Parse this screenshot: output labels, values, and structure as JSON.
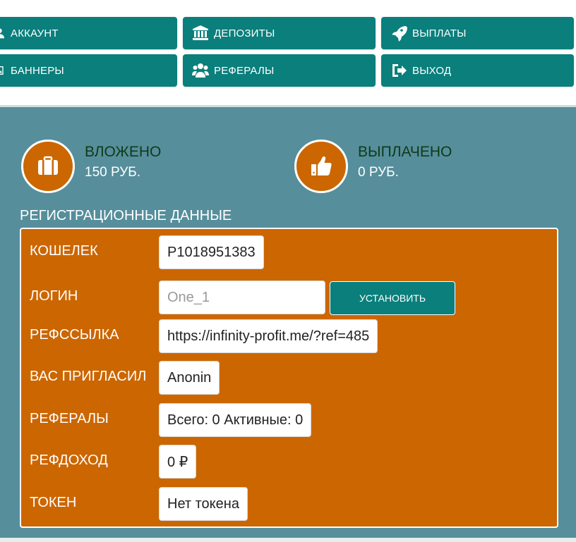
{
  "nav": {
    "account": "АККАУНТ",
    "deposits": "ДЕПОЗИТЫ",
    "payouts": "ВЫПЛАТЫ",
    "banners": "БАННЕРЫ",
    "referrals": "РЕФЕРАЛЫ",
    "logout": "ВЫХОД"
  },
  "stats": {
    "invested": {
      "title": "ВЛОЖЕНО",
      "value": "150 РУБ."
    },
    "paid": {
      "title": "ВЫПЛАЧЕНО",
      "value": "0 РУБ."
    }
  },
  "registration": {
    "title": "РЕГИСТРАЦИОННЫЕ ДАННЫЕ",
    "wallet": {
      "label": "КОШЕЛЕК",
      "value": "P1018951383"
    },
    "login": {
      "label": "ЛОГИН",
      "placeholder": "One_1",
      "button": "УСТАНОВИТЬ"
    },
    "reflink": {
      "label": "РЕФССЫЛКА",
      "value": "https://infinity-profit.me/?ref=485"
    },
    "invited_by": {
      "label": "ВАС ПРИГЛАСИЛ",
      "value": "Anonin"
    },
    "referrals": {
      "label": "РЕФЕРАЛЫ",
      "value": "Всего: 0 Активные: 0"
    },
    "ref_income": {
      "label": "РЕФДОХОД",
      "value": "0 ₽"
    },
    "token": {
      "label": "ТОКЕН",
      "value": "Нет токена"
    }
  },
  "colors": {
    "teal": "#0a7f7c",
    "panel": "#568e9b",
    "orange": "#cc6600",
    "dark_green_title": "#0f3b1a"
  },
  "icons": {
    "account": "user-icon",
    "deposits": "bank-icon",
    "payouts": "rocket-icon",
    "banners": "image-icon",
    "referrals": "users-icon",
    "logout": "sign-out-icon",
    "invested": "briefcase-icon",
    "paid": "thumbs-up-icon"
  }
}
